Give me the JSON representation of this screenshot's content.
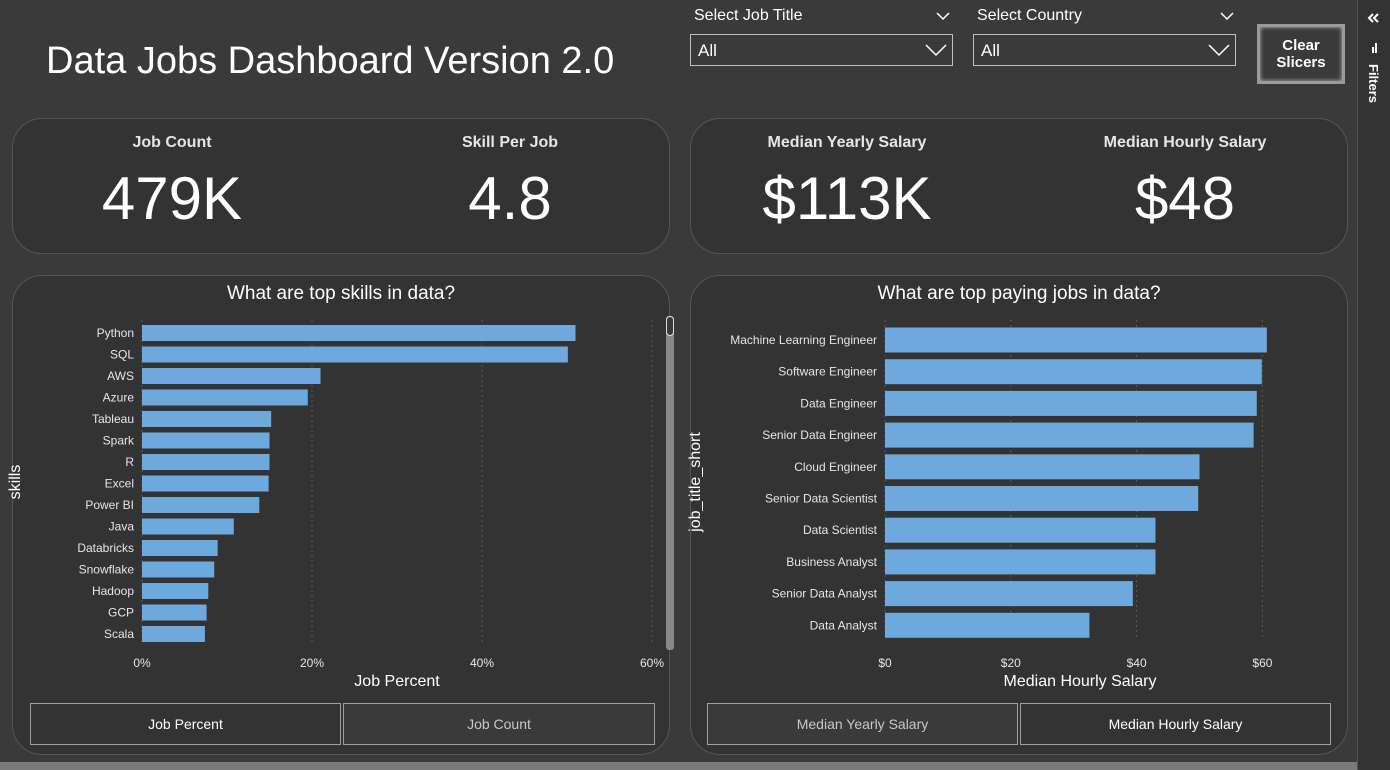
{
  "dashboard": {
    "title": "Data Jobs Dashboard Version 2.0"
  },
  "slicers": {
    "job_title": {
      "label": "Select Job Title",
      "value": "All"
    },
    "country": {
      "label": "Select Country",
      "value": "All"
    },
    "clear_button": "Clear Slicers"
  },
  "kpis": {
    "job_count": {
      "label": "Job Count",
      "value": "479K"
    },
    "skill_per_job": {
      "label": "Skill Per Job",
      "value": "4.8"
    },
    "median_yearly": {
      "label": "Median Yearly Salary",
      "value": "$113K"
    },
    "median_hourly": {
      "label": "Median Hourly Salary",
      "value": "$48"
    }
  },
  "filters_pane": {
    "label": "Filters"
  },
  "skills_toggle": {
    "active": "Job Percent",
    "inactive": "Job Count"
  },
  "salary_toggle": {
    "inactive": "Median Yearly Salary",
    "active": "Median Hourly Salary"
  },
  "colors": {
    "bar": "#6ea9dd",
    "background": "#3a3a3a",
    "card": "#333333"
  },
  "chart_data": [
    {
      "type": "bar",
      "orientation": "horizontal",
      "title": "What are top skills in data?",
      "xlabel": "Job Percent",
      "ylabel": "skills",
      "xlim": [
        0,
        60
      ],
      "xticks": [
        "0%",
        "20%",
        "40%",
        "60%"
      ],
      "grid": true,
      "categories": [
        "Python",
        "SQL",
        "AWS",
        "Azure",
        "Tableau",
        "Spark",
        "R",
        "Excel",
        "Power BI",
        "Java",
        "Databricks",
        "Snowflake",
        "Hadoop",
        "GCP",
        "Scala"
      ],
      "values": [
        51.0,
        50.1,
        21.0,
        19.5,
        15.2,
        15.0,
        15.0,
        14.9,
        13.8,
        10.8,
        8.9,
        8.5,
        7.8,
        7.6,
        7.4
      ]
    },
    {
      "type": "bar",
      "orientation": "horizontal",
      "title": "What are top paying jobs in data?",
      "xlabel": "Median Hourly Salary",
      "ylabel": "job_title_short",
      "xlim": [
        0,
        62
      ],
      "xticks": [
        "$0",
        "$20",
        "$40",
        "$60"
      ],
      "grid": true,
      "categories": [
        "Machine Learning Engineer",
        "Software Engineer",
        "Data Engineer",
        "Senior Data Engineer",
        "Cloud Engineer",
        "Senior Data Scientist",
        "Data Scientist",
        "Business Analyst",
        "Senior Data Analyst",
        "Data Analyst"
      ],
      "values": [
        60.7,
        59.9,
        59.1,
        58.6,
        50.0,
        49.8,
        43.0,
        43.0,
        39.4,
        32.5
      ]
    }
  ]
}
